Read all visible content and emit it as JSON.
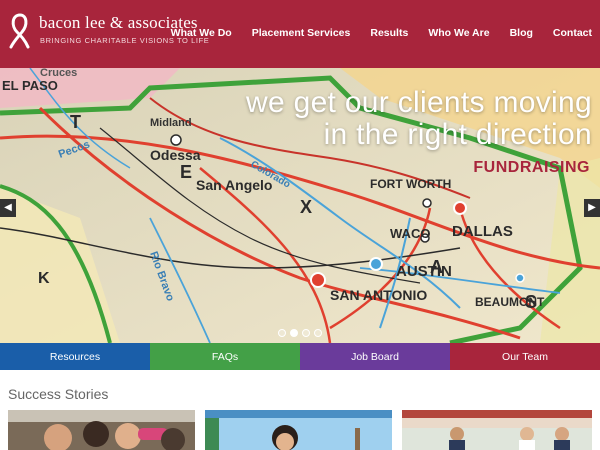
{
  "brand": {
    "name": "bacon lee & associates",
    "tagline": "BRINGING CHARITABLE VISIONS TO LIFE",
    "color": "#a8253c"
  },
  "nav": {
    "items": [
      {
        "label": "What We Do"
      },
      {
        "label": "Placement Services"
      },
      {
        "label": "Results"
      },
      {
        "label": "Who We Are"
      },
      {
        "label": "Blog"
      },
      {
        "label": "Contact"
      }
    ]
  },
  "hero": {
    "line1": "we get our clients moving",
    "line2": "in the right direction",
    "tag": "FUNDRAISING",
    "prev_icon": "chevron-left-icon",
    "next_icon": "chevron-right-icon",
    "slides": 4,
    "active_slide": 2,
    "map_labels": [
      "EL PASO",
      "Midland",
      "Odessa",
      "San Angelo",
      "Colorado",
      "FORT WORTH",
      "WACO",
      "DALLAS",
      "AUSTIN",
      "SAN ANTONIO",
      "BEAUMONT",
      "Rio Bravo",
      "Pecos",
      "Cruces",
      "T",
      "E",
      "X",
      "A",
      "S",
      "K"
    ]
  },
  "quick_links": [
    {
      "label": "Resources",
      "color": "#1a5ea9"
    },
    {
      "label": "FAQs",
      "color": "#43a047"
    },
    {
      "label": "Job Board",
      "color": "#6a3b9b"
    },
    {
      "label": "Our Team",
      "color": "#a8253c"
    }
  ],
  "success": {
    "title": "Success Stories"
  }
}
